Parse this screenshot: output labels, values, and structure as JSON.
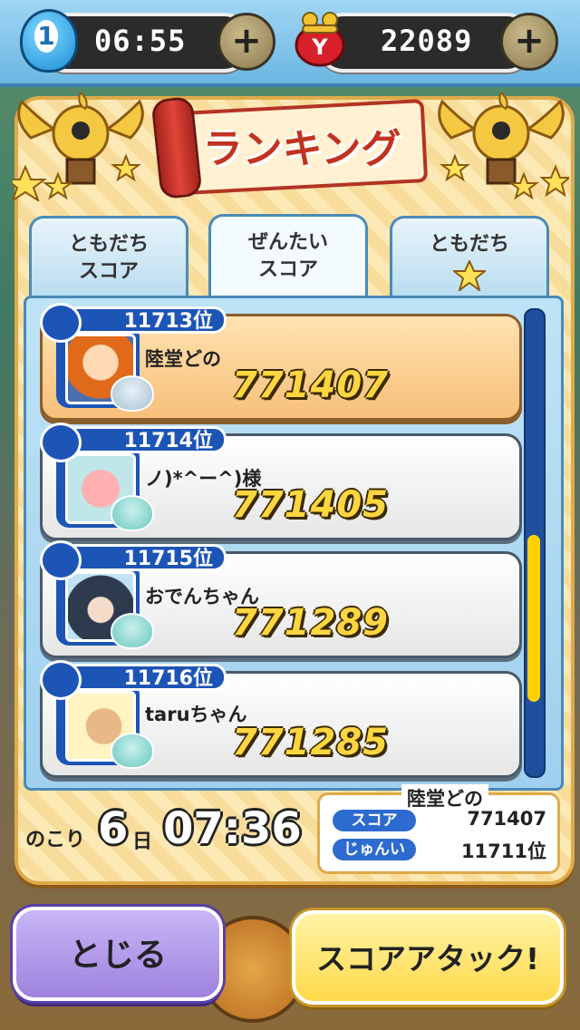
{
  "status": {
    "stamina_count": "1",
    "timer": "06:55",
    "currency": "22089",
    "plus_label": "+"
  },
  "title": "ランキング",
  "tabs": [
    {
      "line1": "ともだち",
      "line2": "スコア"
    },
    {
      "line1": "ぜんたい",
      "line2": "スコア"
    },
    {
      "line1": "ともだち",
      "line2": ""
    }
  ],
  "ranking": [
    {
      "rank": "11713位",
      "name": "陸堂どの",
      "score": "771407"
    },
    {
      "rank": "11714位",
      "name": "ノ)*^ー^)様",
      "score": "771405"
    },
    {
      "rank": "11715位",
      "name": "おでんちゃん",
      "score": "771289"
    },
    {
      "rank": "11716位",
      "name": "taruちゃん",
      "score": "771285"
    }
  ],
  "remaining": {
    "label": "のこり",
    "days": "6",
    "day_unit": "日",
    "time": "07:36"
  },
  "my_summary": {
    "name": "陸堂どの",
    "score_label": "スコア",
    "score_value": "771407",
    "rank_label": "じゅんい",
    "rank_value": "11711位"
  },
  "buttons": {
    "close": "とじる",
    "score_attack": "スコアアタック!"
  },
  "colors": {
    "accent_blue": "#1d55b6",
    "score_gold": "#ffd640",
    "panel_orange": "#e0aa4a"
  },
  "scroll_position": 0.55
}
